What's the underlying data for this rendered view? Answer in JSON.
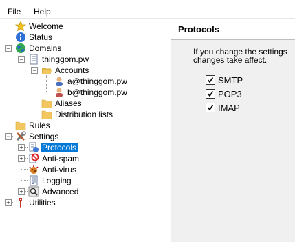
{
  "menu": {
    "file": "File",
    "help": "Help"
  },
  "tree": {
    "welcome": "Welcome",
    "status": "Status",
    "domains": "Domains",
    "domain": "thinggom.pw",
    "accounts": "Accounts",
    "account1": "a@thinggom.pw",
    "account2": "b@thinggom.pw",
    "aliases": "Aliases",
    "distribution_lists": "Distribution lists",
    "rules": "Rules",
    "settings": "Settings",
    "protocols": "Protocols",
    "antispam": "Anti-spam",
    "antivirus": "Anti-virus",
    "logging": "Logging",
    "advanced": "Advanced",
    "utilities": "Utilities"
  },
  "panel": {
    "title": "Protocols",
    "info_line1": "If you change the settings",
    "info_line2": "changes take affect.",
    "options": [
      {
        "label": "SMTP",
        "checked": true
      },
      {
        "label": "POP3",
        "checked": true
      },
      {
        "label": "IMAP",
        "checked": true
      }
    ]
  },
  "colors": {
    "selection": "#0078d7",
    "folder": "#f3c75f"
  }
}
